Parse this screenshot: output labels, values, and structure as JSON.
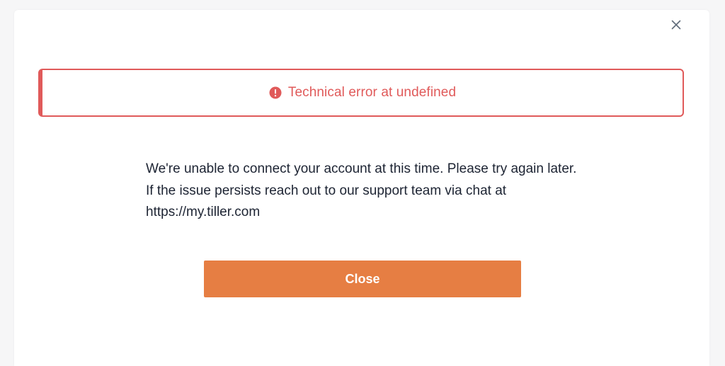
{
  "dialog": {
    "close_icon": "close-icon",
    "error_banner": {
      "icon": "exclamation-circle-icon",
      "text": "Technical error at undefined",
      "color": "#e05a5a"
    },
    "message": "We're unable to connect your account at this time. Please try again later. If the issue persists reach out to our support team via chat at https://my.tiller.com",
    "close_button_label": "Close",
    "accent_color": "#e67e43"
  }
}
